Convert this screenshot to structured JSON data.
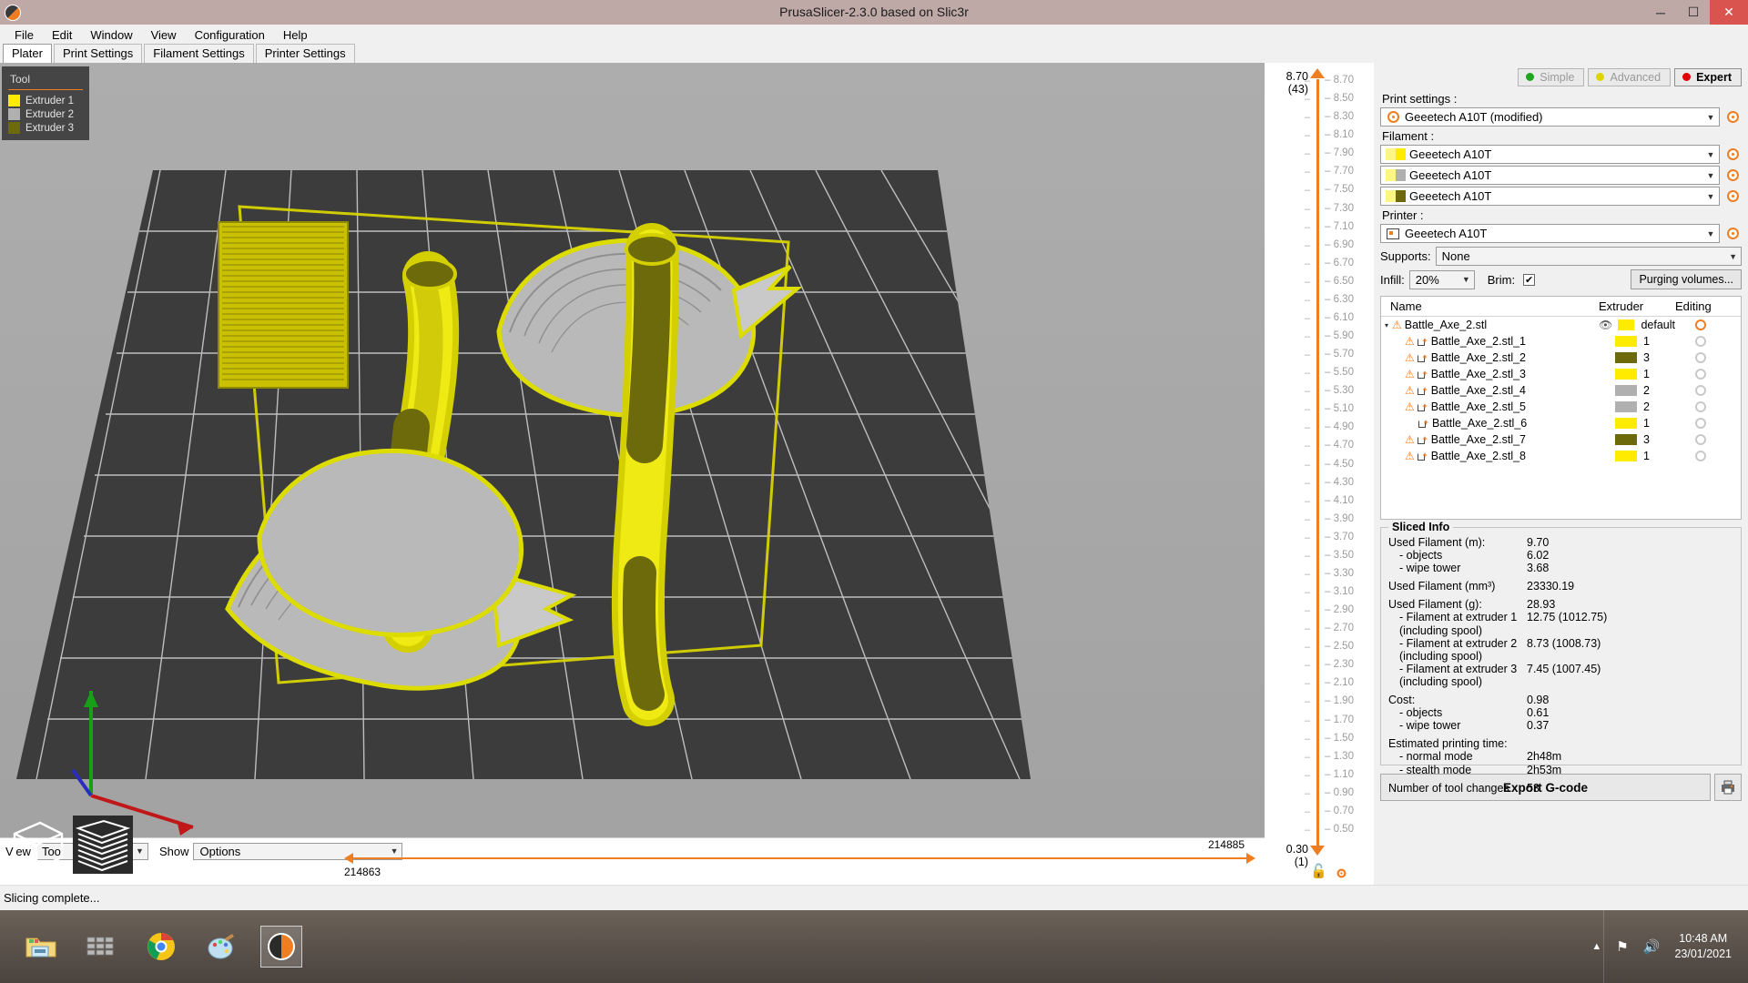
{
  "window": {
    "title": "PrusaSlicer-2.3.0 based on Slic3r",
    "minimize": "─",
    "maximize": "☐",
    "close": "✕"
  },
  "menu": [
    "File",
    "Edit",
    "Window",
    "View",
    "Configuration",
    "Help"
  ],
  "tabs": [
    {
      "label": "Plater",
      "active": true
    },
    {
      "label": "Print Settings",
      "active": false
    },
    {
      "label": "Filament Settings",
      "active": false
    },
    {
      "label": "Printer Settings",
      "active": false
    }
  ],
  "viewport": {
    "legend_title": "Tool",
    "legend_items": [
      {
        "label": "Extruder 1",
        "color": "#ffeb00"
      },
      {
        "label": "Extruder 2",
        "color": "#b0b0b0"
      },
      {
        "label": "Extruder 3",
        "color": "#6d6a0c"
      }
    ]
  },
  "bottom_slider": {
    "view_label": "View",
    "view_value": "Tool",
    "show_label": "Show",
    "show_value": "Options",
    "value_left": "214863",
    "value_right": "214885"
  },
  "layer_slider": {
    "top_value": "8.70",
    "top_index": "(43)",
    "bottom_value": "0.30",
    "bottom_index": "(1)",
    "ticks": [
      "8.70",
      "8.50",
      "8.30",
      "8.10",
      "7.90",
      "7.70",
      "7.50",
      "7.30",
      "7.10",
      "6.90",
      "6.70",
      "6.50",
      "6.30",
      "6.10",
      "5.90",
      "5.70",
      "5.50",
      "5.30",
      "5.10",
      "4.90",
      "4.70",
      "4.50",
      "4.30",
      "4.10",
      "3.90",
      "3.70",
      "3.50",
      "3.30",
      "3.10",
      "2.90",
      "2.70",
      "2.50",
      "2.30",
      "2.10",
      "1.90",
      "1.70",
      "1.50",
      "1.30",
      "1.10",
      "0.90",
      "0.70",
      "0.50"
    ]
  },
  "modes": [
    {
      "label": "Simple",
      "color": "#1ea81e",
      "active": false
    },
    {
      "label": "Advanced",
      "color": "#ded500",
      "active": false
    },
    {
      "label": "Expert",
      "color": "#e00000",
      "active": true
    }
  ],
  "presets": {
    "print_label": "Print settings :",
    "print_value": "Geeetech A10T (modified)",
    "filament_label": "Filament :",
    "filaments": [
      {
        "value": "Geeetech A10T",
        "color_a": "#fdf584",
        "color_b": "#ffeb00"
      },
      {
        "value": "Geeetech A10T",
        "color_a": "#fdf584",
        "color_b": "#b0b0b0"
      },
      {
        "value": "Geeetech A10T",
        "color_a": "#fdf584",
        "color_b": "#6d6a0c"
      }
    ],
    "printer_label": "Printer :",
    "printer_value": "Geeetech A10T"
  },
  "options": {
    "supports_label": "Supports:",
    "supports_value": "None",
    "infill_label": "Infill:",
    "infill_value": "20%",
    "brim_label": "Brim:",
    "brim_checked": true,
    "brim_mark": "✔",
    "purging_label": "Purging volumes..."
  },
  "object_list": {
    "columns": {
      "name": "Name",
      "extruder": "Extruder",
      "editing": "Editing"
    },
    "rows": [
      {
        "name": "Battle_Axe_2.stl",
        "extruder": "default",
        "color": "#ffeb00",
        "warn": true,
        "root": true,
        "eye": true,
        "edit_on": true
      },
      {
        "name": "Battle_Axe_2.stl_1",
        "extruder": "1",
        "color": "#ffeb00",
        "warn": true,
        "root": false,
        "eye": false,
        "edit_on": false
      },
      {
        "name": "Battle_Axe_2.stl_2",
        "extruder": "3",
        "color": "#6d6a0c",
        "warn": true,
        "root": false,
        "eye": false,
        "edit_on": false
      },
      {
        "name": "Battle_Axe_2.stl_3",
        "extruder": "1",
        "color": "#ffeb00",
        "warn": true,
        "root": false,
        "eye": false,
        "edit_on": false
      },
      {
        "name": "Battle_Axe_2.stl_4",
        "extruder": "2",
        "color": "#b0b0b0",
        "warn": true,
        "root": false,
        "eye": false,
        "edit_on": false
      },
      {
        "name": "Battle_Axe_2.stl_5",
        "extruder": "2",
        "color": "#b0b0b0",
        "warn": true,
        "root": false,
        "eye": false,
        "edit_on": false
      },
      {
        "name": "Battle_Axe_2.stl_6",
        "extruder": "1",
        "color": "#ffeb00",
        "warn": false,
        "root": false,
        "eye": false,
        "edit_on": false
      },
      {
        "name": "Battle_Axe_2.stl_7",
        "extruder": "3",
        "color": "#6d6a0c",
        "warn": true,
        "root": false,
        "eye": false,
        "edit_on": false
      },
      {
        "name": "Battle_Axe_2.stl_8",
        "extruder": "1",
        "color": "#ffeb00",
        "warn": true,
        "root": false,
        "eye": false,
        "edit_on": false
      }
    ]
  },
  "sliced_info": {
    "title": "Sliced Info",
    "rows": [
      {
        "key": "Used Filament (m):",
        "value": "9.70",
        "indent": false,
        "gap_after": false
      },
      {
        "key": "- objects",
        "value": "6.02",
        "indent": true,
        "gap_after": false
      },
      {
        "key": "- wipe tower",
        "value": "3.68",
        "indent": true,
        "gap_after": true
      },
      {
        "key": "Used Filament (mm³)",
        "value": "23330.19",
        "indent": false,
        "gap_after": true
      },
      {
        "key": "Used Filament (g):",
        "value": "28.93",
        "indent": false,
        "gap_after": false
      },
      {
        "key": "- Filament at extruder 1",
        "value": "12.75 (1012.75)",
        "indent": true,
        "gap_after": false
      },
      {
        "key": "(including spool)",
        "value": "",
        "indent": true,
        "gap_after": false
      },
      {
        "key": "- Filament at extruder 2",
        "value": "8.73 (1008.73)",
        "indent": true,
        "gap_after": false
      },
      {
        "key": "(including spool)",
        "value": "",
        "indent": true,
        "gap_after": false
      },
      {
        "key": "- Filament at extruder 3",
        "value": "7.45 (1007.45)",
        "indent": true,
        "gap_after": false
      },
      {
        "key": "(including spool)",
        "value": "",
        "indent": true,
        "gap_after": true
      },
      {
        "key": "Cost:",
        "value": "0.98",
        "indent": false,
        "gap_after": false
      },
      {
        "key": "- objects",
        "value": "0.61",
        "indent": true,
        "gap_after": false
      },
      {
        "key": "- wipe tower",
        "value": "0.37",
        "indent": true,
        "gap_after": true
      },
      {
        "key": "Estimated printing time:",
        "value": "",
        "indent": false,
        "gap_after": false
      },
      {
        "key": "- normal mode",
        "value": "2h48m",
        "indent": true,
        "gap_after": false
      },
      {
        "key": "- stealth mode",
        "value": "2h53m",
        "indent": true,
        "gap_after": true
      },
      {
        "key": "Number of tool changes",
        "value": "53",
        "indent": false,
        "gap_after": false
      }
    ]
  },
  "export": {
    "label": "Export G-code",
    "send_icon": "send-to-printer-icon"
  },
  "statusbar": {
    "text": "Slicing complete..."
  },
  "taskbar": {
    "apps": [
      "file-explorer-icon",
      "windows-store-icon",
      "google-chrome-icon",
      "paint-icon",
      "prusaslicer-icon"
    ],
    "tray": [
      "show-hidden-icons-icon",
      "network-icon",
      "volume-icon"
    ],
    "time": "10:48 AM",
    "date": "23/01/2021"
  },
  "colors": {
    "accent": "#ef7d22",
    "titlebar": "#bfa9a6",
    "viewport_bg": "#a9a9a9",
    "bed": "#3c3c3c",
    "extruder1": "#ffeb00",
    "extruder2": "#b0b0b0",
    "extruder3": "#6d6a0c"
  }
}
